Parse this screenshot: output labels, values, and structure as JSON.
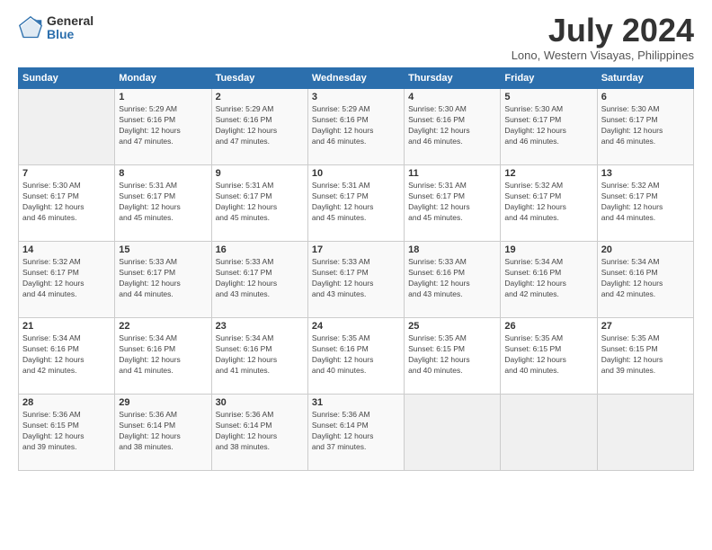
{
  "logo": {
    "general": "General",
    "blue": "Blue"
  },
  "title": "July 2024",
  "location": "Lono, Western Visayas, Philippines",
  "days_header": [
    "Sunday",
    "Monday",
    "Tuesday",
    "Wednesday",
    "Thursday",
    "Friday",
    "Saturday"
  ],
  "weeks": [
    [
      {
        "day": "",
        "info": ""
      },
      {
        "day": "1",
        "info": "Sunrise: 5:29 AM\nSunset: 6:16 PM\nDaylight: 12 hours\nand 47 minutes."
      },
      {
        "day": "2",
        "info": "Sunrise: 5:29 AM\nSunset: 6:16 PM\nDaylight: 12 hours\nand 47 minutes."
      },
      {
        "day": "3",
        "info": "Sunrise: 5:29 AM\nSunset: 6:16 PM\nDaylight: 12 hours\nand 46 minutes."
      },
      {
        "day": "4",
        "info": "Sunrise: 5:30 AM\nSunset: 6:16 PM\nDaylight: 12 hours\nand 46 minutes."
      },
      {
        "day": "5",
        "info": "Sunrise: 5:30 AM\nSunset: 6:17 PM\nDaylight: 12 hours\nand 46 minutes."
      },
      {
        "day": "6",
        "info": "Sunrise: 5:30 AM\nSunset: 6:17 PM\nDaylight: 12 hours\nand 46 minutes."
      }
    ],
    [
      {
        "day": "7",
        "info": "Sunrise: 5:30 AM\nSunset: 6:17 PM\nDaylight: 12 hours\nand 46 minutes."
      },
      {
        "day": "8",
        "info": "Sunrise: 5:31 AM\nSunset: 6:17 PM\nDaylight: 12 hours\nand 45 minutes."
      },
      {
        "day": "9",
        "info": "Sunrise: 5:31 AM\nSunset: 6:17 PM\nDaylight: 12 hours\nand 45 minutes."
      },
      {
        "day": "10",
        "info": "Sunrise: 5:31 AM\nSunset: 6:17 PM\nDaylight: 12 hours\nand 45 minutes."
      },
      {
        "day": "11",
        "info": "Sunrise: 5:31 AM\nSunset: 6:17 PM\nDaylight: 12 hours\nand 45 minutes."
      },
      {
        "day": "12",
        "info": "Sunrise: 5:32 AM\nSunset: 6:17 PM\nDaylight: 12 hours\nand 44 minutes."
      },
      {
        "day": "13",
        "info": "Sunrise: 5:32 AM\nSunset: 6:17 PM\nDaylight: 12 hours\nand 44 minutes."
      }
    ],
    [
      {
        "day": "14",
        "info": "Sunrise: 5:32 AM\nSunset: 6:17 PM\nDaylight: 12 hours\nand 44 minutes."
      },
      {
        "day": "15",
        "info": "Sunrise: 5:33 AM\nSunset: 6:17 PM\nDaylight: 12 hours\nand 44 minutes."
      },
      {
        "day": "16",
        "info": "Sunrise: 5:33 AM\nSunset: 6:17 PM\nDaylight: 12 hours\nand 43 minutes."
      },
      {
        "day": "17",
        "info": "Sunrise: 5:33 AM\nSunset: 6:17 PM\nDaylight: 12 hours\nand 43 minutes."
      },
      {
        "day": "18",
        "info": "Sunrise: 5:33 AM\nSunset: 6:16 PM\nDaylight: 12 hours\nand 43 minutes."
      },
      {
        "day": "19",
        "info": "Sunrise: 5:34 AM\nSunset: 6:16 PM\nDaylight: 12 hours\nand 42 minutes."
      },
      {
        "day": "20",
        "info": "Sunrise: 5:34 AM\nSunset: 6:16 PM\nDaylight: 12 hours\nand 42 minutes."
      }
    ],
    [
      {
        "day": "21",
        "info": "Sunrise: 5:34 AM\nSunset: 6:16 PM\nDaylight: 12 hours\nand 42 minutes."
      },
      {
        "day": "22",
        "info": "Sunrise: 5:34 AM\nSunset: 6:16 PM\nDaylight: 12 hours\nand 41 minutes."
      },
      {
        "day": "23",
        "info": "Sunrise: 5:34 AM\nSunset: 6:16 PM\nDaylight: 12 hours\nand 41 minutes."
      },
      {
        "day": "24",
        "info": "Sunrise: 5:35 AM\nSunset: 6:16 PM\nDaylight: 12 hours\nand 40 minutes."
      },
      {
        "day": "25",
        "info": "Sunrise: 5:35 AM\nSunset: 6:15 PM\nDaylight: 12 hours\nand 40 minutes."
      },
      {
        "day": "26",
        "info": "Sunrise: 5:35 AM\nSunset: 6:15 PM\nDaylight: 12 hours\nand 40 minutes."
      },
      {
        "day": "27",
        "info": "Sunrise: 5:35 AM\nSunset: 6:15 PM\nDaylight: 12 hours\nand 39 minutes."
      }
    ],
    [
      {
        "day": "28",
        "info": "Sunrise: 5:36 AM\nSunset: 6:15 PM\nDaylight: 12 hours\nand 39 minutes."
      },
      {
        "day": "29",
        "info": "Sunrise: 5:36 AM\nSunset: 6:14 PM\nDaylight: 12 hours\nand 38 minutes."
      },
      {
        "day": "30",
        "info": "Sunrise: 5:36 AM\nSunset: 6:14 PM\nDaylight: 12 hours\nand 38 minutes."
      },
      {
        "day": "31",
        "info": "Sunrise: 5:36 AM\nSunset: 6:14 PM\nDaylight: 12 hours\nand 37 minutes."
      },
      {
        "day": "",
        "info": ""
      },
      {
        "day": "",
        "info": ""
      },
      {
        "day": "",
        "info": ""
      }
    ]
  ]
}
